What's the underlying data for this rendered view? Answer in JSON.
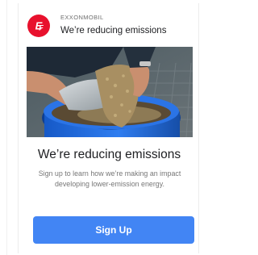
{
  "ad": {
    "brand_name": "EXXONMOBIL",
    "header_title": "We’re reducing emissions",
    "headline": "We’re reducing emissions",
    "body": "Sign up to learn how we’re making an impact developing lower-emission energy.",
    "cta_label": "Sign Up",
    "image_icon": "hands-pouring-grain-into-blue-tub-photo",
    "logo_icon": "exxonmobil-logo-icon"
  },
  "colors": {
    "brand_red": "#e8112d",
    "cta_blue": "#4285f4",
    "headline_text": "#202124",
    "body_text": "#777777"
  }
}
